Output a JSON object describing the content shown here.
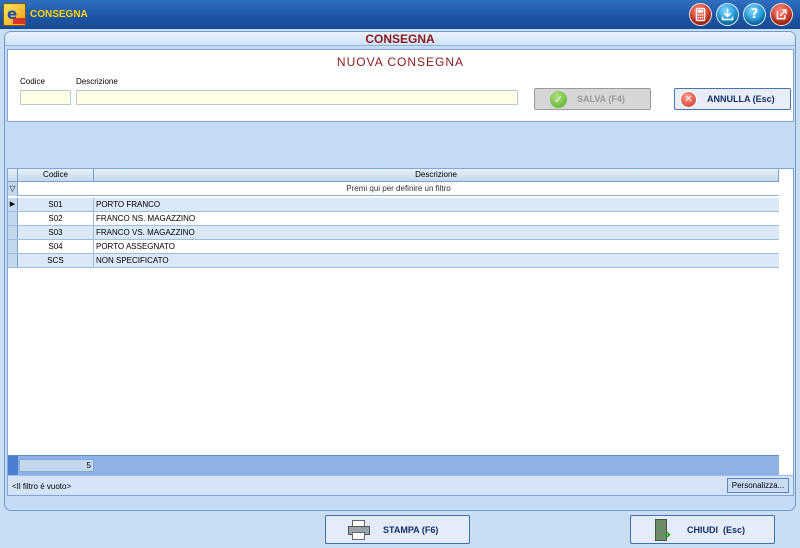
{
  "window": {
    "title": "CONSEGNA",
    "toolbar_icons": [
      "calculator-icon",
      "download-icon",
      "help-icon",
      "exit-icon"
    ],
    "help_glyph": "?"
  },
  "panel": {
    "title": "CONSEGNA"
  },
  "form": {
    "title": "NUOVA CONSEGNA",
    "codice_label": "Codice",
    "descrizione_label": "Descrizione",
    "codice_value": "",
    "descrizione_value": "",
    "save_label": "SALVA (F4)",
    "cancel_label": "ANNULLA (Esc)"
  },
  "grid": {
    "columns": [
      "Codice",
      "Descrizione"
    ],
    "filter_prompt": "Premi qui per definire un filtro",
    "rows": [
      {
        "code": "S01",
        "desc": "PORTO FRANCO"
      },
      {
        "code": "S02",
        "desc": "FRANCO NS. MAGAZZINO"
      },
      {
        "code": "S03",
        "desc": "FRANCO VS. MAGAZZINO"
      },
      {
        "code": "S04",
        "desc": "PORTO ASSEGNATO"
      },
      {
        "code": "SCS",
        "desc": "NON SPECIFICATO"
      }
    ],
    "count": "5",
    "filter_status": "<Il filtro è vuoto>",
    "customize_label": "Personalizza..."
  },
  "footer": {
    "print_label": "STAMPA (F6)",
    "close_label": "CHIUDI  (Esc)"
  },
  "colors": {
    "accent": "#1d55a4",
    "title_text": "#8b1a1a",
    "window_title": "#ffd400"
  }
}
